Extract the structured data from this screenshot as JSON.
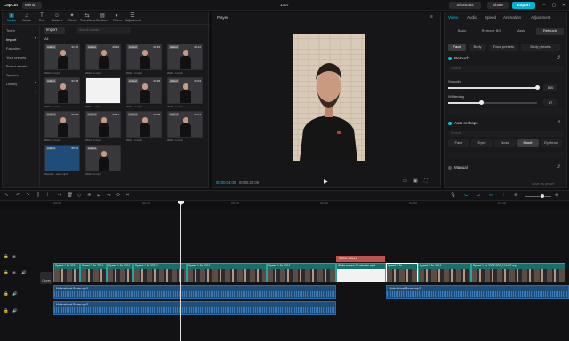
{
  "app": {
    "logo": "CapCut",
    "menu_label": "Menu",
    "project_title": "1307",
    "shortcuts_label": "Shortcuts",
    "share_label": "Share",
    "export_label": "Export",
    "accent": "#00c8e0"
  },
  "media": {
    "tabs": [
      {
        "label": "Media",
        "icon": "media-icon"
      },
      {
        "label": "Audio",
        "icon": "audio-icon"
      },
      {
        "label": "Text",
        "icon": "text-icon"
      },
      {
        "label": "Stickers",
        "icon": "stickers-icon"
      },
      {
        "label": "Effects",
        "icon": "effects-icon"
      },
      {
        "label": "Transitions",
        "icon": "transitions-icon"
      },
      {
        "label": "Captions",
        "icon": "captions-icon"
      },
      {
        "label": "Filters",
        "icon": "filters-icon"
      },
      {
        "label": "Adjustment",
        "icon": "adjustment-icon"
      }
    ],
    "side_items": [
      "Team",
      "Import",
      "Favorites",
      "Your presets",
      "Brand assets",
      "Spaces",
      "Library"
    ],
    "import_label": "Import",
    "search_placeholder": "Search media",
    "all_label": "All",
    "thumbs": [
      {
        "badge": "Added",
        "dur": "01:30",
        "cap": "2024...1.mp4"
      },
      {
        "badge": "Added",
        "dur": "00:10",
        "cap": "2024...1.mp4"
      },
      {
        "badge": "Added",
        "dur": "00:15",
        "cap": "2024...1.mp4"
      },
      {
        "badge": "Added",
        "dur": "00:12",
        "cap": "2024...1.mp4"
      },
      {
        "badge": "Added",
        "dur": "01:38",
        "cap": "2024...1.mp4"
      },
      {
        "badge": "",
        "dur": "",
        "cap": "White ...mp4"
      },
      {
        "badge": "Added",
        "dur": "01:28",
        "cap": "2024...1.mp4"
      },
      {
        "badge": "Added",
        "dur": "01:04",
        "cap": "2024...1.mp4"
      },
      {
        "badge": "Added",
        "dur": "00:08",
        "cap": "2024...1.mp4"
      },
      {
        "badge": "Added",
        "dur": "00:51",
        "cap": "2024...1.mp4"
      },
      {
        "badge": "Added",
        "dur": "00:38",
        "cap": "2024...1.mp4"
      },
      {
        "badge": "Added",
        "dur": "00:47",
        "cap": "2024...1.mp4"
      },
      {
        "badge": "Added",
        "dur": "05:52",
        "cap": "Motivati...ower.mp3"
      },
      {
        "badge": "Added",
        "dur": "",
        "cap": "2024...1.mp4"
      }
    ]
  },
  "player": {
    "title": "Player",
    "timecode_current": "00:00:04:00",
    "timecode_total": "00:05:22:09"
  },
  "props": {
    "tabs": [
      "Video",
      "Audio",
      "Speed",
      "Animation",
      "Adjustment"
    ],
    "sub_tabs": [
      "Basic",
      "Remove BG",
      "Mask",
      "Retouch"
    ],
    "face_tabs": [
      "Face",
      "Body",
      "Face presets",
      "Body presets"
    ],
    "retouch_label": "Retouch",
    "smooth_label": "Smooth",
    "smooth_value": "100",
    "smooth_level": 1.0,
    "whitening_label": "Whitening",
    "whitening_value": "37",
    "whitening_level": 0.37,
    "auto_reshape_label": "Auto reshape",
    "reshape_options": [
      "Face",
      "Eyes",
      "Nose",
      "Mouth",
      "Eyebrow"
    ],
    "manual_label": "Manual",
    "save_preset_label": "Save as preset"
  },
  "timeline": {
    "ruler_marks": [
      "00:00",
      "00:10",
      "00:20",
      "00:30",
      "01:00",
      "01:10"
    ],
    "cover_label": "Cover",
    "sticker_label": "STEM CELLS",
    "video_clips": [
      {
        "cap": "Speed 1.5x  2024..."
      },
      {
        "cap": "Speed 1.5x  2024..."
      },
      {
        "cap": "Speed 1.5x  2024..."
      },
      {
        "cap": "Speed 1.5x  20241..."
      },
      {
        "cap": "Speed 1.5x  2024..."
      },
      {
        "cap": "Speed 1.5x  2024..."
      },
      {
        "cap": "White screen 10 minutes.mp4"
      },
      {
        "cap": "Speed 1.5x"
      },
      {
        "cap": "Speed 1.5x  2024..."
      },
      {
        "cap": "Speed 1.5x  20241007_114432.mp4"
      }
    ],
    "audio_top": [
      "Motivational Power.mp3",
      "Motivational Power.mp3"
    ],
    "audio_bottom": [
      "Motivational Power.mp3"
    ]
  }
}
